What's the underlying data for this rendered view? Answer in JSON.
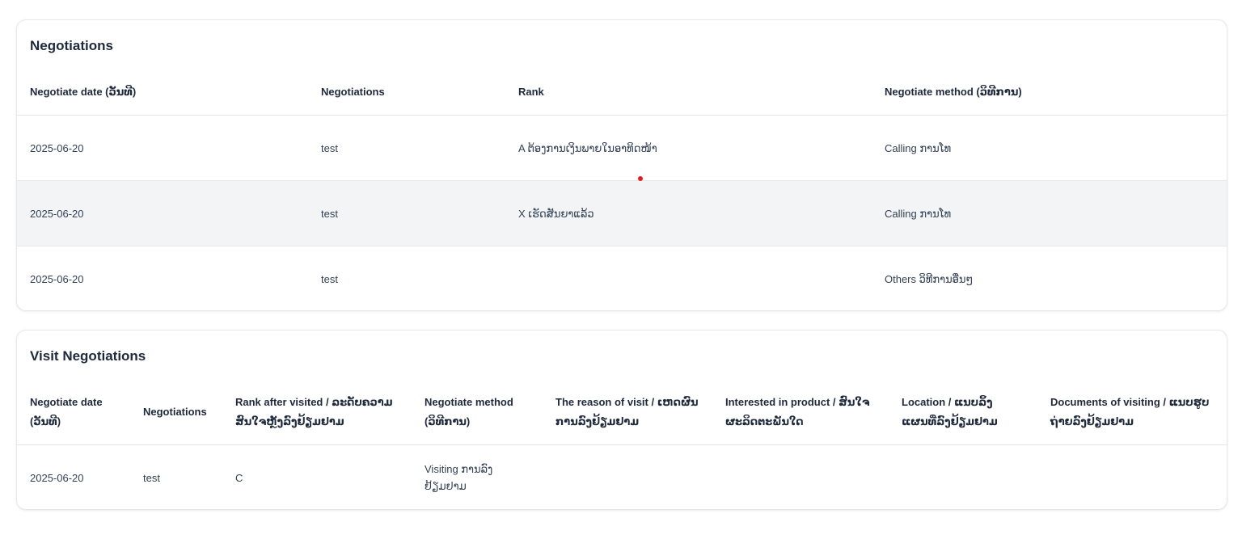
{
  "negotiations": {
    "title": "Negotiations",
    "columns": [
      "Negotiate date (ວັນທີ)",
      "Negotiations",
      "Rank",
      "Negotiate method (ວິທີການ)"
    ],
    "rows": [
      [
        "2025-06-20",
        "test",
        "A ຕ້ອງການເງິນພາຍໃນອາທິດໜ້າ",
        "Calling ການໂທ"
      ],
      [
        "2025-06-20",
        "test",
        "X ເຮັດສັນຍາແລ້ວ",
        "Calling ການໂທ"
      ],
      [
        "2025-06-20",
        "test",
        "",
        "Others ວິທີການອື່ນໆ"
      ]
    ]
  },
  "visit_negotiations": {
    "title": "Visit Negotiations",
    "columns": [
      "Negotiate date (ວັນທີ)",
      "Negotiations",
      "Rank after visited / ລະດັບຄວາມສົນໃຈຫຼັງລົງຢ້ຽມຢາມ",
      "Negotiate method (ວິທີການ)",
      "The reason of visit / ເຫດຜົນການລົງຢ້ຽມຢາມ",
      "Interested in product / ສົນໃຈຜະລິດຕະພັນໃດ",
      "Location / ແນບລິ້ງແຜນທີ່ລົງຢ້ຽມຢາມ",
      "Documents of visiting / ແນບຮູບຖ່າຍລົງຢ້ຽມຢາມ"
    ],
    "rows": [
      [
        "2025-06-20",
        "test",
        "C",
        "Visiting ການລົງຢ້ຽມຢາມ",
        "",
        "",
        "",
        ""
      ]
    ]
  },
  "colors": {
    "border": "#e5e7eb",
    "row_alt": "#f3f4f6",
    "heading": "#1e293b",
    "marker": "#e11d1d"
  }
}
